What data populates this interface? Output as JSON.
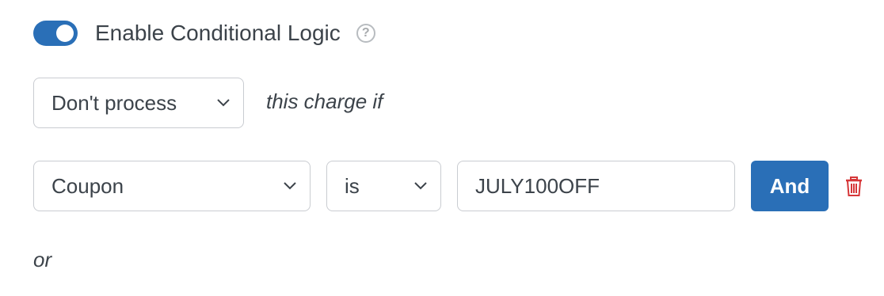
{
  "toggle": {
    "label": "Enable Conditional Logic",
    "enabled": true,
    "help_icon": "question-circle-icon",
    "help_glyph": "?"
  },
  "action": {
    "selected": "Don't process",
    "suffix": "this charge if"
  },
  "rule": {
    "field": "Coupon",
    "operator": "is",
    "value": "JULY100OFF",
    "and_label": "And",
    "delete_icon": "trash-icon"
  },
  "or_label": "or",
  "colors": {
    "accent": "#2a6fb7",
    "danger": "#d63638",
    "text": "#3c434a",
    "border": "#c9ccd1"
  }
}
